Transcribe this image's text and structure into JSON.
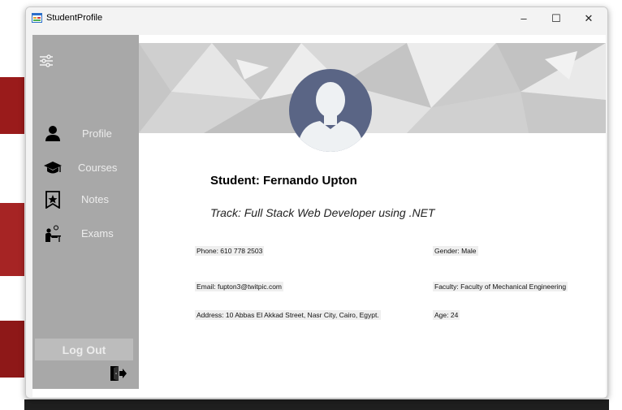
{
  "window": {
    "title": "StudentProfile",
    "minimize_label": "–",
    "maximize_label": "☐",
    "close_label": "✕"
  },
  "sidebar": {
    "settings_icon": "sliders-icon",
    "items": [
      {
        "label": "Profile",
        "icon": "user-icon"
      },
      {
        "label": "Courses",
        "icon": "graduation-cap-icon"
      },
      {
        "label": "Notes",
        "icon": "bookmark-star-icon"
      },
      {
        "label": "Exams",
        "icon": "exam-desk-icon"
      }
    ],
    "logout_label": "Log Out",
    "logout_icon": "door-exit-icon"
  },
  "profile": {
    "student_name": "Student: Fernando Upton",
    "track": "Track: Full Stack Web Developer using .NET",
    "phone": "Phone: 610 778 2503",
    "email": "Email: fupton3@twitpic.com",
    "address": "Address: 10 Abbas El Akkad Street, Nasr City, Cairo, Egypt.",
    "gender": "Gender: Male",
    "faculty": "Faculty: Faculty of Mechanical Engineering",
    "age": "Age: 24"
  },
  "colors": {
    "sidebar_bg": "#a8a8a8",
    "avatar_bg": "#5a6585",
    "avatar_fg": "#eef1f3"
  }
}
